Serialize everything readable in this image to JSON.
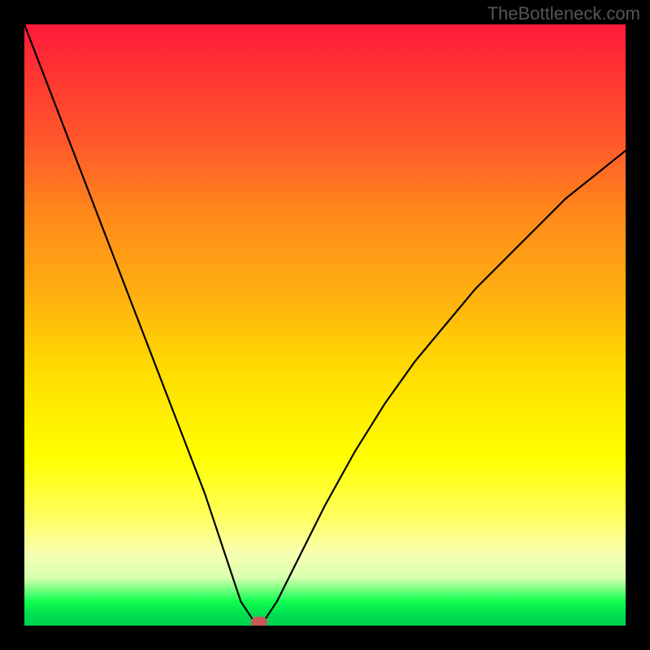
{
  "watermark": "TheBottleneck.com",
  "chart_data": {
    "type": "line",
    "title": "",
    "xlabel": "",
    "ylabel": "",
    "xlim": [
      0,
      100
    ],
    "ylim": [
      0,
      100
    ],
    "grid": false,
    "series": [
      {
        "name": "bottleneck-curve",
        "x": [
          0,
          5,
          10,
          15,
          20,
          25,
          30,
          34,
          36,
          38,
          39,
          40,
          42,
          45,
          50,
          55,
          60,
          65,
          70,
          75,
          80,
          85,
          90,
          95,
          100
        ],
        "y": [
          100,
          87,
          74,
          61,
          48,
          35,
          22,
          10,
          4,
          1,
          0,
          1,
          4,
          10,
          20,
          29,
          37,
          44,
          50,
          56,
          61,
          66,
          71,
          75,
          79
        ]
      }
    ],
    "minimum_point": {
      "x": 39,
      "y": 0
    },
    "background_gradient": {
      "top": "#ff1a3a",
      "mid": "#ffff00",
      "bottom": "#00d050"
    }
  }
}
